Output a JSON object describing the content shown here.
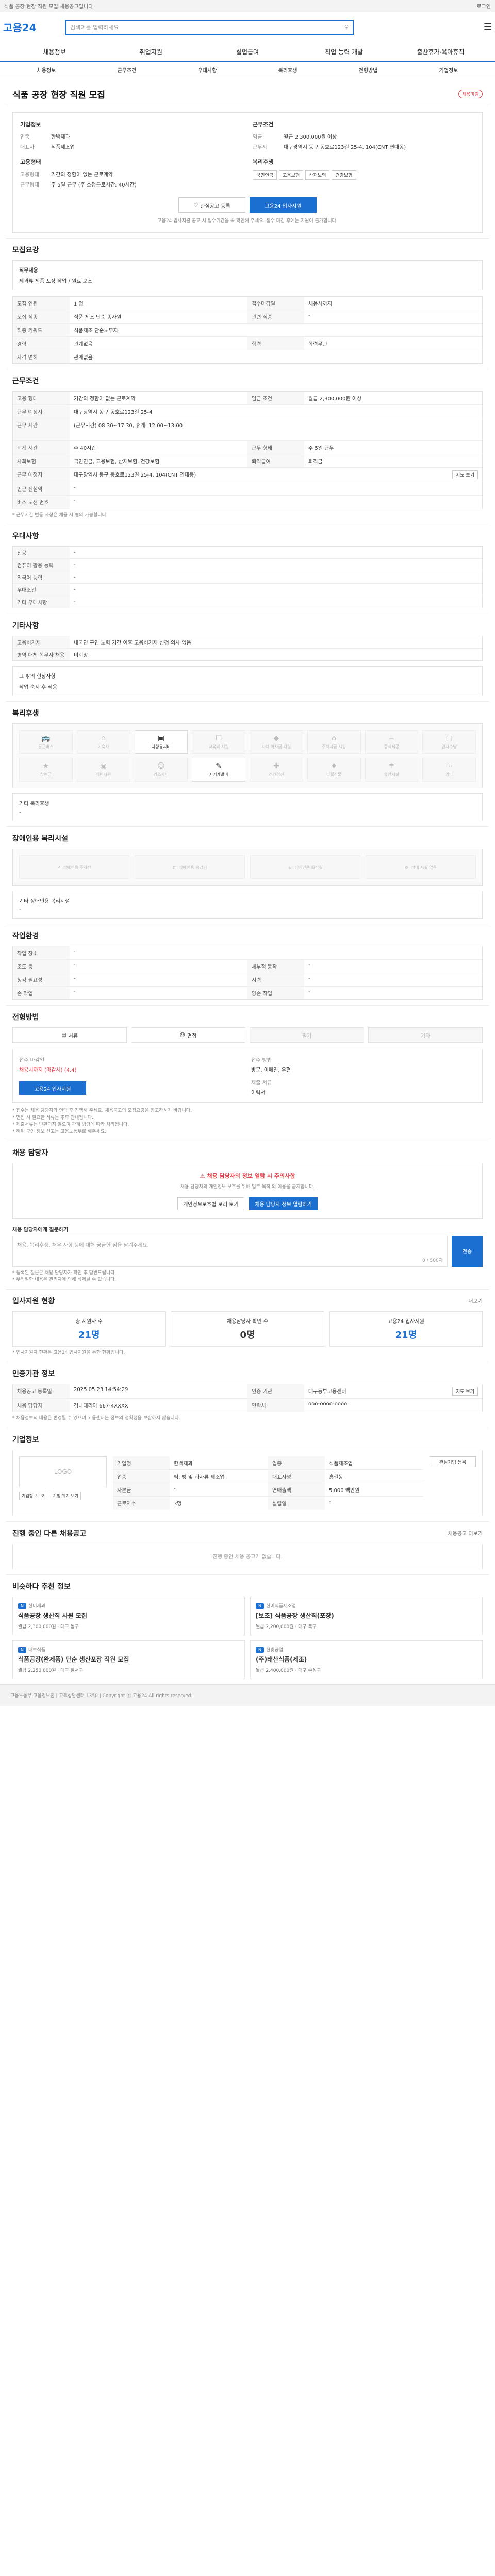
{
  "topbar": {
    "notice": "식품 공장 현장 직원 모집 채용공고입니다",
    "login": "로그인"
  },
  "header": {
    "logo": "고용24",
    "search_placeholder": "검색어를 입력하세요"
  },
  "nav": {
    "items": [
      "채용정보",
      "취업지원",
      "실업급여",
      "직업 능력 개발",
      "출산휴가·육아휴직"
    ]
  },
  "subnav": {
    "items": [
      "채용정보",
      "근무조건",
      "우대사항",
      "복리후생",
      "전형방법",
      "기업정보"
    ]
  },
  "title": {
    "badge": "채용마감",
    "text": "식품 공장 현장 직원 모집"
  },
  "company_box": {
    "left_title": "기업정보",
    "right_title": "근무조건",
    "rows_left": [
      [
        "업종",
        "한백제과"
      ],
      [
        "대표자",
        "식품제조업"
      ]
    ],
    "rows_right": [
      [
        "임금",
        "월급 2,300,000원 이상"
      ],
      [
        "근무지",
        "대구광역시 동구 동호로123길 25-4, 104(CNT 연대동)"
      ]
    ],
    "cond_title": "고용형태",
    "cond_right_title": "복리후생",
    "cond_rows": [
      [
        "고용형태",
        "기간의 정함이 없는 근로계약"
      ],
      [
        "근무형태",
        "주 5일 근무 (주 소정근로시간: 40시간)"
      ]
    ],
    "benefits": [
      "국민연금",
      "고용보험",
      "산재보험",
      "건강보험"
    ],
    "btn_bookmark": "관심공고 등록",
    "btn_apply": "고용24 입사지원",
    "note": "고용24 입사지원 공고 시 접수기간을 꼭 확인해 주세요. 접수 마감 후에는 지원이 불가합니다."
  },
  "recruit": {
    "title": "모집요강",
    "job_desc_label": "직무내용",
    "job_desc": "제과류 제품 포장 작업 / 원료 보조",
    "rows": [
      [
        "모집 인원",
        "1 명",
        "접수마감일",
        "채용시까지"
      ],
      [
        "모집 직종",
        "식품 제조 단순 종사원",
        "관련 직종",
        "-"
      ],
      [
        "직종 키워드",
        "식품제조 단순노무자",
        "",
        ""
      ],
      [
        "경력",
        "관계없음",
        "학력",
        "학력무관"
      ],
      [
        "자격 면허",
        "관계없음",
        "",
        ""
      ]
    ]
  },
  "conditions": {
    "title": "근무조건",
    "rows": [
      [
        "고용 형태",
        "기간의 정함이 없는 근로계약",
        "임금 조건",
        "월급 2,300,000원 이상"
      ],
      [
        "근무 예정지",
        "대구광역시 동구 동호로123길 25-4",
        "",
        ""
      ],
      [
        "근무 시간",
        "(근무시간) 08:30~17:30, 휴게: 12:00~13:00",
        "",
        ""
      ],
      [
        "회계 시간",
        "주 40시간",
        "근무 형태",
        "주 5일 근무"
      ],
      [
        "사회보험",
        "국민연금, 고용보험, 산재보험, 건강보험",
        "퇴직급여",
        "퇴직금"
      ],
      [
        "근무 예정지",
        "대구광역시 동구 동호로123길 25-4, 104(CNT 연대동)",
        "",
        ""
      ],
      [
        "인근 전철역",
        "-",
        "",
        ""
      ],
      [
        "버스 노선 번호",
        "-",
        "",
        ""
      ]
    ],
    "map_btn": "지도 보기",
    "note": "* 근무시간 변동 사항은 채용 시 협의 가능합니다"
  },
  "preferred": {
    "title": "우대사항",
    "rows": [
      [
        "전공",
        "-"
      ],
      [
        "컴퓨터 활용 능력",
        "-"
      ],
      [
        "외국어 능력",
        "-"
      ],
      [
        "우대조건",
        "-"
      ],
      [
        "기타 우대사항",
        "-"
      ]
    ]
  },
  "other": {
    "title": "기타사항",
    "rows": [
      [
        "고용허가제",
        "내국인 구인 노력 기간 이후 고용허가제 신청 의사 없음"
      ],
      [
        "병역 대체 복무자 채용",
        "비희망"
      ]
    ],
    "extra_label": "그 밖의 현장사항",
    "extra_value": "작업 숙지 후 적응"
  },
  "welfare": {
    "title": "복리후생",
    "items": [
      "통근버스",
      "기숙사",
      "차량유지비",
      "교육비 지원",
      "자녀 학자금 지원",
      "주택자금 지원",
      "중식제공",
      "연차수당",
      "상여금",
      "식비지원",
      "경조사비",
      "자기계발비",
      "건강검진",
      "명절선물",
      "휴양시설",
      "기타"
    ],
    "other_label": "기타 복리후생",
    "other_value": "-"
  },
  "disability": {
    "title": "장애인용 복리시설",
    "items": [
      "장애인용 주차장",
      "장애인용 승강기",
      "장애인용 화장실",
      "장애 시설 없음"
    ],
    "other_label": "기타 장애인용 복리시설",
    "other_value": "-"
  },
  "work_env": {
    "title": "작업환경",
    "rows": [
      [
        "작업 장소",
        "-",
        "",
        ""
      ],
      [
        "조도 등",
        "-",
        "세부적 동작",
        "-"
      ],
      [
        "청각 필요성",
        "-",
        "시력",
        "-"
      ],
      [
        "손 작업",
        "-",
        "양손 작업",
        "-"
      ]
    ]
  },
  "selection": {
    "title": "전형방법",
    "steps": [
      "서류",
      "면접",
      "필기",
      "기타"
    ],
    "period_label": "접수 마감일",
    "period_value": "채용시까지 (마감시) (4.4)",
    "method_label": "접수 방법",
    "method_value": "방문, 이메일, 우편",
    "docs_label": "제출 서류",
    "docs_value": "이력서",
    "btn_apply": "고용24 입사지원",
    "notes": [
      "* 접수는 채용 담당자와 연락 후 진행해 주세요. 채용공고의 모집요강을 참고하시기 바랍니다.",
      "* 면접 시 필요한 서류는 추후 안내됩니다.",
      "* 제출서류는 반환되지 않으며 관계 법령에 따라 처리됩니다.",
      "* 허위 구인 정보 신고는 고용노동부로 해주세요."
    ]
  },
  "contact": {
    "title": "채용 담당자",
    "notice_title": "채용 담당자의 정보 열람 시 주의사항",
    "notice_text": "채용 담당자의 개인정보 보호를 위해 업무 목적 외 이용을 금지합니다.",
    "btn1": "개인정보보호법 보러 보기",
    "btn2": "채용 담당자 정보 열람하기",
    "msg_label": "채용 담당자에게 질문하기",
    "msg_placeholder": "채용, 복리후생, 처우 사항 등에 대해 궁금한 점을 남겨주세요.",
    "msg_counter": "0 / 500자",
    "btn_send": "전송",
    "notes": [
      "* 등록된 질문은 채용 담당자가 확인 후 답변드립니다.",
      "* 부적절한 내용은 관리자에 의해 삭제될 수 있습니다."
    ]
  },
  "stats": {
    "title": "입사지원 현황",
    "more": "더보기",
    "items": [
      [
        "총 지원자 수",
        "21명"
      ],
      [
        "채용담당자 확인 수",
        "0명"
      ],
      [
        "고용24 입사지원",
        "21명"
      ]
    ],
    "note": "* 입사지원자 현황은 고용24 입사지원을 통한 현황입니다."
  },
  "authority": {
    "title": "인증기관 정보",
    "rows": [
      [
        "채용공고 등록일",
        "2025.05.23 14:54:29",
        "인증 기관",
        "대구동부고용센터"
      ],
      [
        "채용 담당자",
        "경나태리아 667-4XXXX",
        "연락처",
        "ooo-oooo-oooo"
      ]
    ],
    "map_btn": "지도 보기",
    "note": "* 채용정보의 내용은 변경될 수 있으며 고용센터는 정보의 정확성을 보장하지 않습니다."
  },
  "company": {
    "title": "기업정보",
    "logo_placeholder": "LOGO",
    "rows": [
      [
        "기업명",
        "한백제과",
        "업종",
        "식품제조업"
      ],
      [
        "업종",
        "떡, 빵 및 과자류 제조업",
        "대표자명",
        "홍길동"
      ],
      [
        "자본금",
        "-",
        "연매출액",
        "5,000 백만원"
      ],
      [
        "근로자수",
        "3명",
        "설립일",
        "-"
      ]
    ],
    "btns": [
      "기업정보 보기",
      "기업 위치 보기",
      "관심기업 등록"
    ]
  },
  "other_jobs": {
    "title": "진행 중인 다른 채용공고",
    "empty": "진행 중인 채용 공고가 없습니다.",
    "more": "채용공고 더보기"
  },
  "similar": {
    "title": "비슷하다 추천 정보",
    "items": [
      {
        "company": "한미제과",
        "title": "식품공장 생산직 사원 모집",
        "wage": "월급 2,300,000원",
        "place": "대구 동구"
      },
      {
        "company": "한미식품제조업",
        "title": "[보조] 식품공장 생산직(포장)",
        "wage": "월급 2,200,000원",
        "place": "대구 북구"
      },
      {
        "company": "대보식품",
        "title": "식품공장(완제품) 단순 생산포장 직원 모집",
        "wage": "월급 2,250,000원",
        "place": "대구 달서구"
      },
      {
        "company": "한빛공업",
        "title": "(주)태산식품(제조)",
        "wage": "월급 2,400,000원",
        "place": "대구 수성구"
      }
    ]
  },
  "footer": {
    "text": "고용노동부 고용정보원 | 고객상담센터 1350 | Copyright ⓒ 고용24 All rights reserved."
  }
}
